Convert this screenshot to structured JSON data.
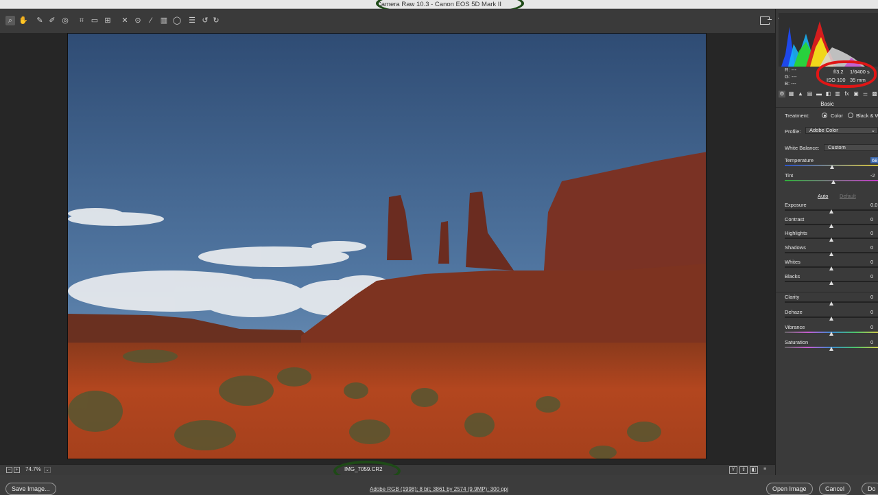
{
  "window": {
    "title": "Camera Raw 10.3  -  Canon EOS 5D Mark II"
  },
  "toolbar": {
    "tools": [
      {
        "name": "zoom-tool",
        "glyph": "⌕"
      },
      {
        "name": "hand-tool",
        "glyph": "✋"
      },
      {
        "name": "white-balance-tool",
        "glyph": "✎"
      },
      {
        "name": "color-sampler-tool",
        "glyph": "✐"
      },
      {
        "name": "targeted-adjustment-tool",
        "glyph": "◎"
      },
      {
        "name": "crop-tool",
        "glyph": "⌗"
      },
      {
        "name": "straighten-tool",
        "glyph": "▭"
      },
      {
        "name": "transform-tool",
        "glyph": "⊞"
      },
      {
        "name": "spot-removal-tool",
        "glyph": "✕"
      },
      {
        "name": "red-eye-removal-tool",
        "glyph": "⊙"
      },
      {
        "name": "adjustment-brush-tool",
        "glyph": "⁄"
      },
      {
        "name": "graduated-filter-tool",
        "glyph": "▥"
      },
      {
        "name": "radial-filter-tool",
        "glyph": "◯"
      },
      {
        "name": "open-preferences-tool",
        "glyph": "☰"
      },
      {
        "name": "rotate-left-tool",
        "glyph": "↺"
      },
      {
        "name": "rotate-right-tool",
        "glyph": "↻"
      }
    ]
  },
  "status": {
    "zoom_out": "−",
    "zoom_in": "+",
    "zoom": "74.7%",
    "zoom_dd": "⌄",
    "filename": "IMG_7059.CR2",
    "views": [
      "Y",
      "⇕",
      "◧",
      "≡"
    ]
  },
  "bottom": {
    "save": "Save Image...",
    "workflow": "Adobe RGB (1998); 8 bit; 3861 by 2574 (9.9MP); 300 ppi",
    "open": "Open Image",
    "cancel": "Cancel",
    "done": "Do"
  },
  "histogram": {
    "r": "R:",
    "g": "G:",
    "b": "B:",
    "dash": "---"
  },
  "exif": {
    "aperture": "f/3.2",
    "shutter": "1/6400 s",
    "iso": "ISO 100",
    "focal": "35 mm"
  },
  "panel": {
    "tabs": [
      "⚙",
      "▦",
      "▲",
      "▤",
      "▬",
      "◧",
      "▥",
      "fx",
      "▣",
      "⚌",
      "▩"
    ],
    "section": "Basic",
    "treatment_label": "Treatment:",
    "treatment_color": "Color",
    "treatment_bw": "Black & W",
    "profile_label": "Profile:",
    "profile_value": "Adobe Color",
    "profile_dd": "⌄",
    "wb_label": "White Balance:",
    "wb_value": "Custom",
    "auto": "Auto",
    "default": "Default",
    "sliders_wb": [
      {
        "label": "Temperature",
        "value": "68",
        "pos": 0.51
      },
      {
        "label": "Tint",
        "value": "-2",
        "pos": 0.52
      }
    ],
    "sliders_tone": [
      {
        "label": "Exposure",
        "value": "0.0",
        "pos": 0.5
      },
      {
        "label": "Contrast",
        "value": "0",
        "pos": 0.5
      },
      {
        "label": "Highlights",
        "value": "0",
        "pos": 0.5
      },
      {
        "label": "Shadows",
        "value": "0",
        "pos": 0.5
      },
      {
        "label": "Whites",
        "value": "0",
        "pos": 0.5
      },
      {
        "label": "Blacks",
        "value": "0",
        "pos": 0.5
      }
    ],
    "sliders_presence": [
      {
        "label": "Clarity",
        "value": "0",
        "pos": 0.5
      },
      {
        "label": "Dehaze",
        "value": "0",
        "pos": 0.5
      },
      {
        "label": "Vibrance",
        "value": "0",
        "pos": 0.5
      },
      {
        "label": "Saturation",
        "value": "0",
        "pos": 0.5
      }
    ]
  },
  "colors": {
    "accent": "#3d6ab0",
    "annotation_red": "#e01616",
    "annotation_green": "#1e4a17"
  }
}
